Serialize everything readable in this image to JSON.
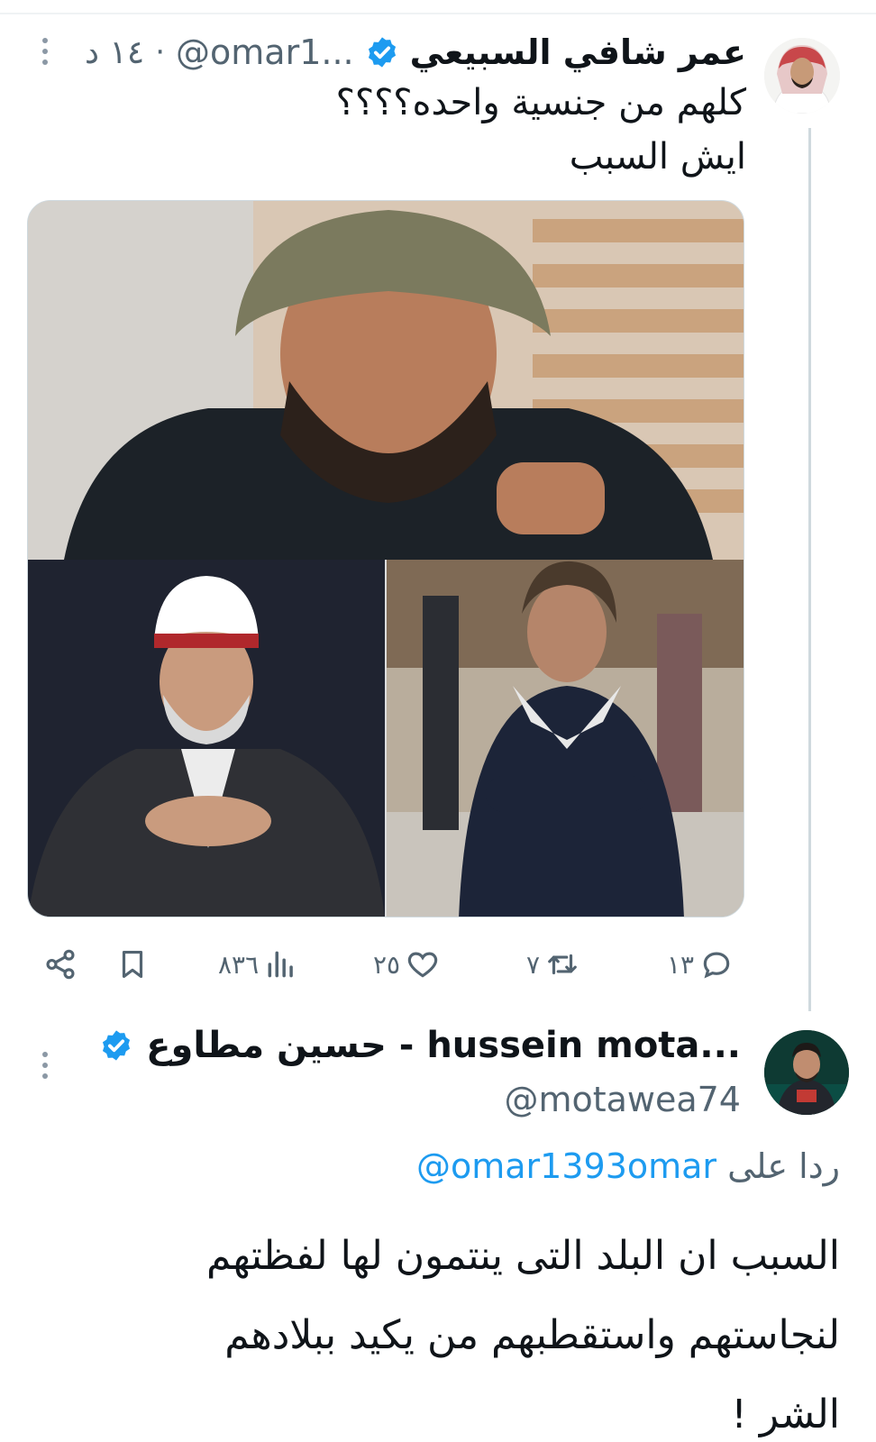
{
  "tweet": {
    "author_name": "عمر شافي السبيعي",
    "handle": "@omar1...",
    "separator": "·",
    "time": "١٤ د",
    "text_line1": "كلهم من جنسية واحده؟؟؟؟",
    "text_line2": "ايش السبب",
    "actions": {
      "replies": "١٣",
      "retweets": "٧",
      "likes": "٢٥",
      "views": "٨٣٦"
    }
  },
  "reply": {
    "author_name": "حسين مطاوع - hussein mota...",
    "handle": "@motawea74",
    "reply_prefix": "ردا على",
    "reply_mention": "@omar1393omar",
    "text_line1": "السبب ان البلد التى ينتمون لها لفظتهم",
    "text_line2": "لنجاستهم واستقطبهم من يكيد ببلادهم",
    "text_line3": "الشر !"
  },
  "icons": {
    "verified": "verified-badge-icon",
    "more": "more-vertical-icon",
    "reply": "reply-icon",
    "retweet": "retweet-icon",
    "like": "heart-icon",
    "views": "views-icon",
    "bookmark": "bookmark-icon",
    "share": "share-icon"
  },
  "colors": {
    "accent": "#1d9bf0",
    "secondary_text": "#536471",
    "primary_text": "#0f1419",
    "thread_line": "#cfd9de"
  }
}
